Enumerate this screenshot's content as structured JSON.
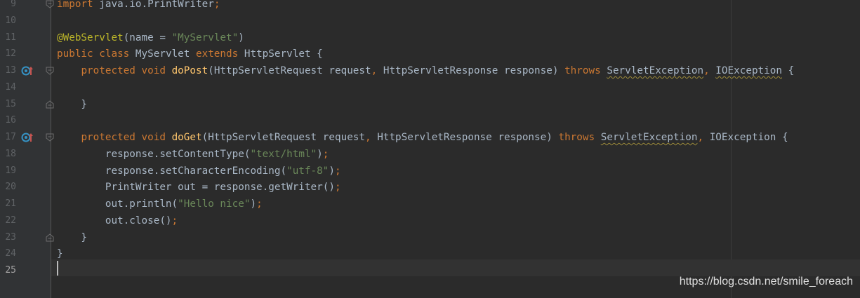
{
  "editor": {
    "lines": [
      {
        "number": "9",
        "tokens": [
          {
            "t": "import",
            "c": "kw"
          },
          {
            "t": " java.io.PrintWriter"
          },
          {
            "t": ";",
            "c": "punc"
          }
        ],
        "fold": "start"
      },
      {
        "number": "10",
        "tokens": []
      },
      {
        "number": "11",
        "tokens": [
          {
            "t": "@WebServlet",
            "c": "ann"
          },
          {
            "t": "(name = "
          },
          {
            "t": "\"MyServlet\"",
            "c": "str"
          },
          {
            "t": ")"
          }
        ]
      },
      {
        "number": "12",
        "tokens": [
          {
            "t": "public class ",
            "c": "kw"
          },
          {
            "t": "MyServlet "
          },
          {
            "t": "extends ",
            "c": "kw"
          },
          {
            "t": "HttpServlet {"
          }
        ]
      },
      {
        "number": "13",
        "icon": "override-icon",
        "fold": "start",
        "tokens": [
          {
            "t": "    "
          },
          {
            "t": "protected void ",
            "c": "kw"
          },
          {
            "t": "doPost",
            "c": "method"
          },
          {
            "t": "(HttpServletRequest request"
          },
          {
            "t": ", ",
            "c": "punc"
          },
          {
            "t": "HttpServletResponse response) "
          },
          {
            "t": "throws ",
            "c": "kw"
          },
          {
            "t": "ServletException",
            "w": true
          },
          {
            "t": ", ",
            "c": "punc"
          },
          {
            "t": "IOException",
            "w": true
          },
          {
            "t": " {"
          }
        ]
      },
      {
        "number": "14",
        "tokens": []
      },
      {
        "number": "15",
        "fold": "end",
        "tokens": [
          {
            "t": "    }"
          }
        ]
      },
      {
        "number": "16",
        "tokens": []
      },
      {
        "number": "17",
        "icon": "override-icon",
        "fold": "start",
        "tokens": [
          {
            "t": "    "
          },
          {
            "t": "protected void ",
            "c": "kw"
          },
          {
            "t": "doGet",
            "c": "method"
          },
          {
            "t": "(HttpServletRequest request"
          },
          {
            "t": ", ",
            "c": "punc"
          },
          {
            "t": "HttpServletResponse response) "
          },
          {
            "t": "throws ",
            "c": "kw"
          },
          {
            "t": "ServletException",
            "w": true
          },
          {
            "t": ", ",
            "c": "punc"
          },
          {
            "t": "IOException {"
          }
        ]
      },
      {
        "number": "18",
        "tokens": [
          {
            "t": "        response.setContentType("
          },
          {
            "t": "\"text/html\"",
            "c": "str"
          },
          {
            "t": ")"
          },
          {
            "t": ";",
            "c": "punc"
          }
        ]
      },
      {
        "number": "19",
        "tokens": [
          {
            "t": "        response.setCharacterEncoding("
          },
          {
            "t": "\"utf-8\"",
            "c": "str"
          },
          {
            "t": ")"
          },
          {
            "t": ";",
            "c": "punc"
          }
        ]
      },
      {
        "number": "20",
        "tokens": [
          {
            "t": "        PrintWriter out = response.getWriter()"
          },
          {
            "t": ";",
            "c": "punc"
          }
        ]
      },
      {
        "number": "21",
        "tokens": [
          {
            "t": "        out.println("
          },
          {
            "t": "\"Hello nice\"",
            "c": "str"
          },
          {
            "t": ")"
          },
          {
            "t": ";",
            "c": "punc"
          }
        ]
      },
      {
        "number": "22",
        "tokens": [
          {
            "t": "        out.close()"
          },
          {
            "t": ";",
            "c": "punc"
          }
        ]
      },
      {
        "number": "23",
        "fold": "end",
        "tokens": [
          {
            "t": "    }"
          }
        ]
      },
      {
        "number": "24",
        "tokens": [
          {
            "t": "}"
          }
        ]
      },
      {
        "number": "25",
        "current": true,
        "tokens": []
      }
    ]
  },
  "watermark": "https://blog.csdn.net/smile_foreach",
  "colors": {
    "background": "#2b2b2b",
    "gutter": "#313335",
    "keyword": "#cc7832",
    "string": "#6a8759",
    "annotation": "#bbb529",
    "method": "#ffc66d",
    "text": "#a9b7c6"
  }
}
